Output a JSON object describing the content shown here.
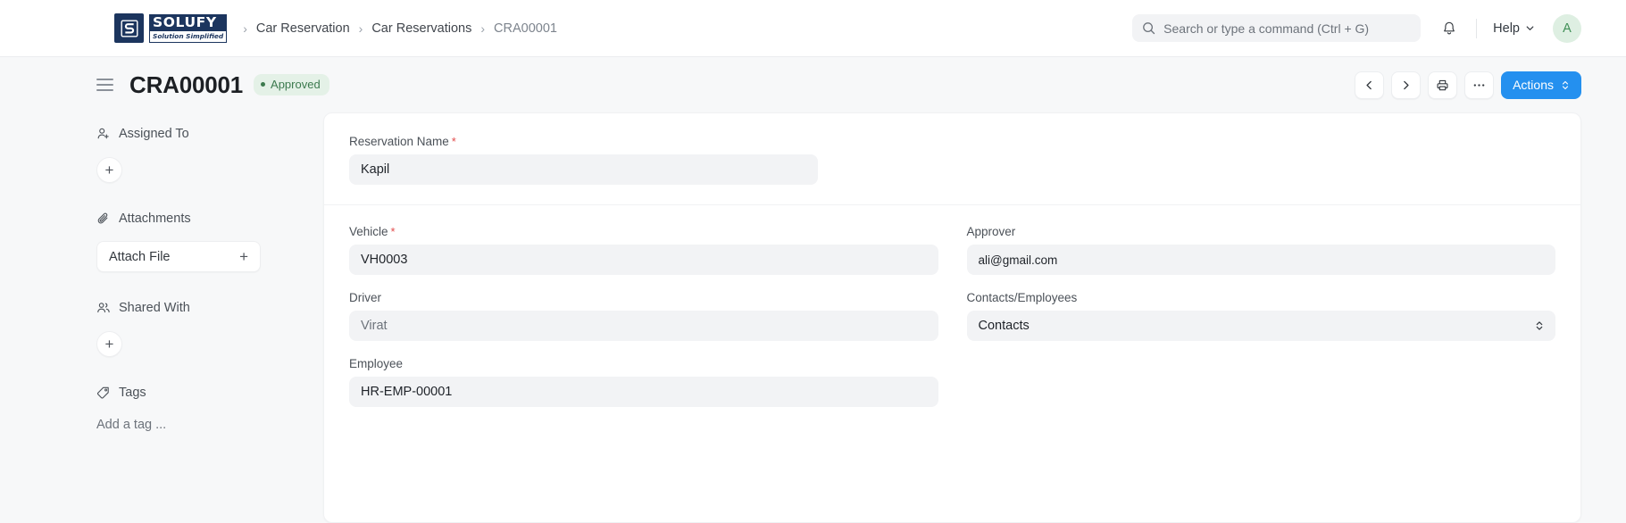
{
  "navbar": {
    "logo": {
      "mark_letter": "S",
      "word_top": "SOLUFY",
      "word_bottom": "Solution Simplified",
      "brand_color": "#1c355e"
    },
    "breadcrumbs": [
      {
        "label": "Car Reservation"
      },
      {
        "label": "Car Reservations"
      },
      {
        "label": "CRA00001"
      }
    ],
    "separator": "›",
    "search": {
      "placeholder": "Search or type a command (Ctrl + G)",
      "icon": "search-icon"
    },
    "notifications_icon": "bell-icon",
    "help": {
      "label": "Help",
      "icon": "chevron-down-icon"
    },
    "avatar": {
      "initial": "A",
      "bg": "#deefe2",
      "color": "#3f8f56"
    }
  },
  "page_header": {
    "menu_icon": "hamburger-icon",
    "title": "CRA00001",
    "status": {
      "label": "Approved",
      "bg": "#e4f1e7",
      "color": "#3c7a4e"
    },
    "buttons": {
      "prev": "‹",
      "next": "›",
      "print_icon": "printer-icon",
      "more": "···",
      "actions_label": "Actions",
      "actions_color": "#2490ef"
    }
  },
  "sidebar": {
    "sections": [
      {
        "title": "Assigned To",
        "icon": "user-plus-icon",
        "add_label": "+"
      },
      {
        "title": "Attachments",
        "icon": "paperclip-icon",
        "attach_label": "Attach File",
        "add_label": "+"
      },
      {
        "title": "Shared With",
        "icon": "users-icon",
        "add_label": "+"
      },
      {
        "title": "Tags",
        "icon": "tag-icon",
        "placeholder": "Add a tag ..."
      }
    ]
  },
  "form": {
    "reservation_name": {
      "label": "Reservation Name",
      "required": true,
      "value": "Kapil"
    },
    "vehicle": {
      "label": "Vehicle",
      "required": true,
      "value": "VH0003"
    },
    "driver": {
      "label": "Driver",
      "required": false,
      "value": "Virat"
    },
    "employee": {
      "label": "Employee",
      "required": false,
      "value": "HR-EMP-00001"
    },
    "approver": {
      "label": "Approver",
      "required": false,
      "value": "ali@gmail.com"
    },
    "contacts_employees": {
      "label": "Contacts/Employees",
      "required": false,
      "value": "Contacts"
    },
    "required_marker": "*"
  }
}
